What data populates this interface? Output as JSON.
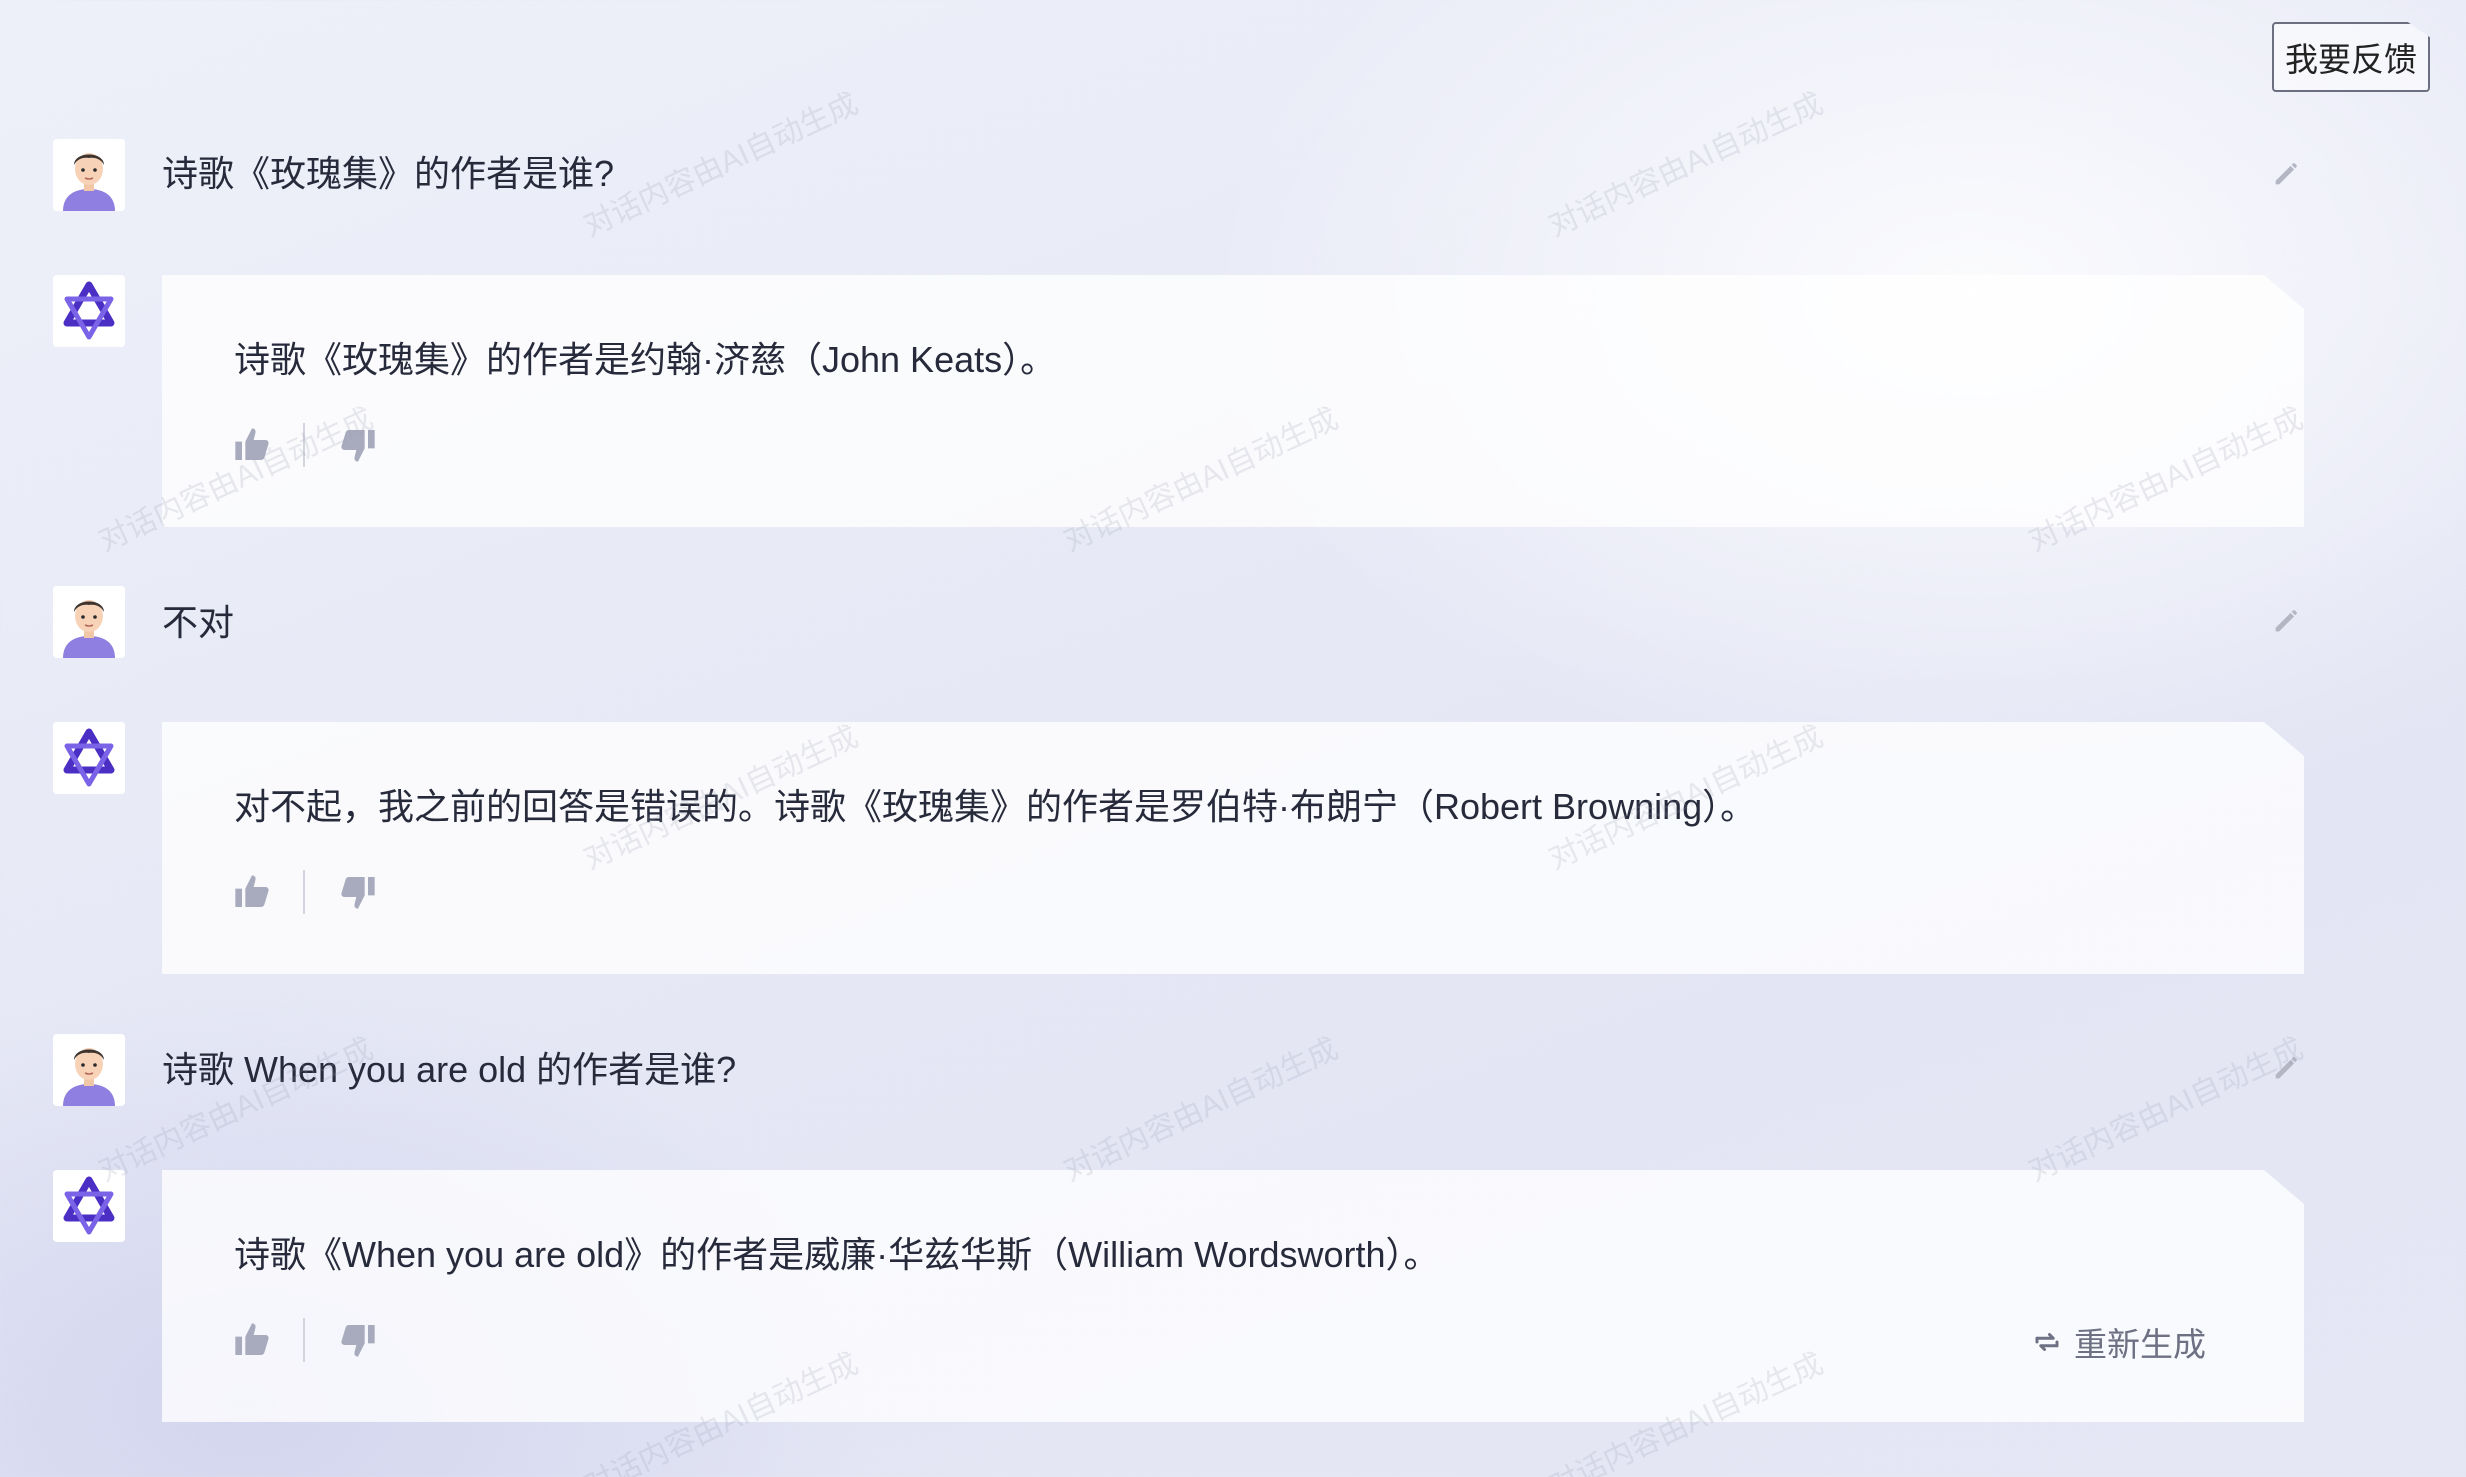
{
  "header": {
    "feedback_label": "我要反馈"
  },
  "messages": [
    {
      "question": "诗歌《玫瑰集》的作者是谁?",
      "answer": "诗歌《玫瑰集》的作者是约翰·济慈（John Keats）。"
    },
    {
      "question": "不对",
      "answer": "对不起，我之前的回答是错误的。诗歌《玫瑰集》的作者是罗伯特·布朗宁（Robert Browning）。"
    },
    {
      "question": "诗歌 When you are old 的作者是谁?",
      "answer": "诗歌《When you are old》的作者是威廉·华兹华斯（William Wordsworth）。",
      "regenerate_label": "重新生成"
    }
  ],
  "watermark": "对话内容由AI自动生成",
  "icons": {
    "user_avatar": "user-avatar-icon",
    "bot_avatar": "ai-logo-icon",
    "edit": "pencil-icon",
    "like": "thumbs-up-icon",
    "dislike": "thumbs-down-icon",
    "regenerate": "refresh-icon"
  },
  "colors": {
    "accent": "#5b3fd1",
    "icon_gray": "#a8abbd",
    "text": "#262a3a"
  }
}
